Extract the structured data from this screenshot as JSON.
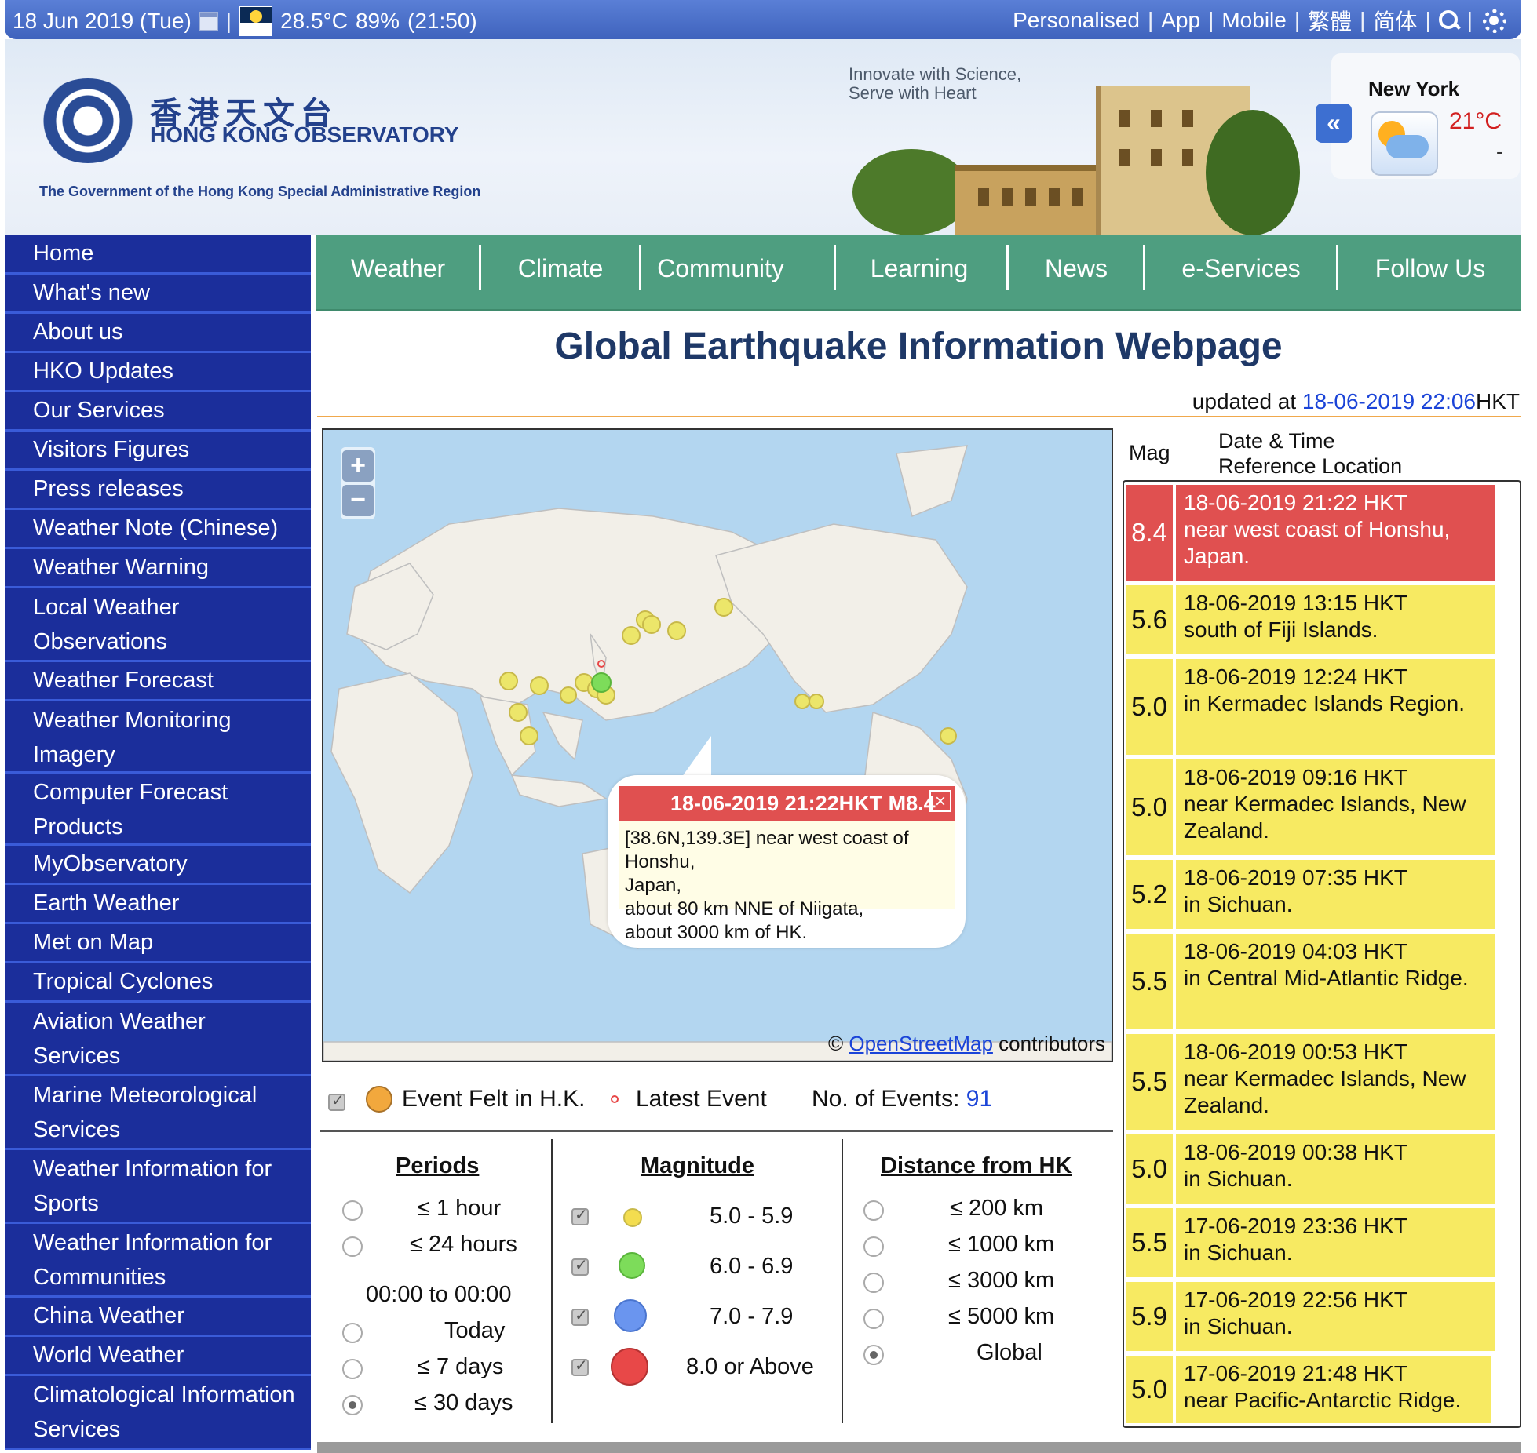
{
  "topbar": {
    "date": "18 Jun 2019 (Tue)",
    "temp": "28.5°C",
    "humidity": "89%",
    "time": "(21:50)",
    "links": [
      "Personalised",
      "App",
      "Mobile",
      "繁體",
      "简体"
    ]
  },
  "banner": {
    "logo_cn": "香港天文台",
    "logo_en": "HONG KONG OBSERVATORY",
    "gov": "The Government of the Hong Kong Special Administrative Region",
    "slogan": "Innovate with Science,\nServe with Heart",
    "city": "New York",
    "city_temp": "21°C",
    "city_dash": "-"
  },
  "sidebar": [
    "Home",
    "What's new",
    "About us",
    "HKO Updates",
    "Our Services",
    "Visitors Figures",
    "Press releases",
    "Weather Note (Chinese)",
    "Weather Warning",
    "Local Weather Observations",
    "Weather Forecast",
    "Weather Monitoring Imagery",
    "Computer Forecast Products",
    "MyObservatory",
    "Earth Weather",
    "Met on Map",
    "Tropical Cyclones",
    "Aviation Weather Services",
    "Marine Meteorological Services",
    "Weather Information for Sports",
    "Weather Information for Communities",
    "China Weather",
    "World Weather",
    "Climatological Information Services"
  ],
  "nav": [
    "Weather",
    "Climate",
    "Community",
    "Learning",
    "News",
    "e-Services",
    "Follow Us"
  ],
  "page": {
    "title": "Global Earthquake Information Webpage",
    "updated_label": "updated at ",
    "updated_ts": "18-06-2019 22:06",
    "updated_tz": "HKT"
  },
  "map": {
    "zoom_in": "+",
    "zoom_out": "−",
    "credit_prefix": "© ",
    "credit_link": "OpenStreetMap",
    "credit_suffix": " contributors",
    "popup_title": "18-06-2019 21:22HKT M8.4",
    "popup_lines": [
      "[38.6N,139.3E] near west coast of Honshu,",
      "Japan,",
      "about 80 km NNE of Niigata,",
      "about 3000 km of HK."
    ],
    "popup_close": "×"
  },
  "legend": {
    "felt": "Event Felt in H.K.",
    "latest": "Latest Event",
    "events_label": "No. of Events: ",
    "events_count": "91"
  },
  "filters": {
    "periods": {
      "title": "Periods",
      "options": [
        "≤  1 hour",
        "≤ 24 hours",
        "Today",
        "≤  7 days",
        "≤ 30 days"
      ],
      "range": "00:00 to 00:00",
      "selected": 4
    },
    "magnitude": {
      "title": "Magnitude",
      "options": [
        "5.0 - 5.9",
        "6.0 - 6.9",
        "7.0 - 7.9",
        "8.0 or Above"
      ],
      "colors": [
        "#f3dd4f",
        "#7ddc5a",
        "#6a95ef",
        "#e84848"
      ]
    },
    "distance": {
      "title": "Distance from HK",
      "options": [
        "≤  200 km",
        "≤  1000 km",
        "≤  3000 km",
        "≤  5000 km",
        "Global"
      ],
      "selected": 4
    }
  },
  "events": {
    "head_mag": "Mag",
    "head_dt": "Date & Time",
    "head_loc": "Reference Location",
    "rows": [
      {
        "mag": "8.4",
        "time": "18-06-2019 21:22 HKT",
        "loc": "near west coast of Honshu, Japan.",
        "level": "red"
      },
      {
        "mag": "5.6",
        "time": "18-06-2019 13:15 HKT",
        "loc": "south of Fiji Islands.",
        "level": "yel"
      },
      {
        "mag": "5.0",
        "time": "18-06-2019 12:24 HKT",
        "loc": "in Kermadec Islands Region.",
        "level": "yel"
      },
      {
        "mag": "5.0",
        "time": "18-06-2019 09:16 HKT",
        "loc": "near Kermadec Islands, New Zealand.",
        "level": "yel"
      },
      {
        "mag": "5.2",
        "time": "18-06-2019 07:35 HKT",
        "loc": "in Sichuan.",
        "level": "yel"
      },
      {
        "mag": "5.5",
        "time": "18-06-2019 04:03 HKT",
        "loc": "in Central Mid-Atlantic Ridge.",
        "level": "yel"
      },
      {
        "mag": "5.5",
        "time": "18-06-2019 00:53 HKT",
        "loc": "near Kermadec Islands, New Zealand.",
        "level": "yel"
      },
      {
        "mag": "5.0",
        "time": "18-06-2019 00:38 HKT",
        "loc": "in Sichuan.",
        "level": "yel"
      },
      {
        "mag": "5.5",
        "time": "17-06-2019 23:36 HKT",
        "loc": "in Sichuan.",
        "level": "yel"
      },
      {
        "mag": "5.9",
        "time": "17-06-2019 22:56 HKT",
        "loc": "in Sichuan.",
        "level": "yel"
      },
      {
        "mag": "5.0",
        "time": "17-06-2019 21:48 HKT",
        "loc": "near Pacific-Antarctic Ridge.",
        "level": "yel"
      }
    ]
  },
  "colors": {
    "sidebar_bg": "#1b2e9b",
    "nav_bg": "#4e9e80",
    "title": "#1e3867",
    "event_red": "#e05050",
    "event_yellow": "#f7ea62",
    "quake_dot": "#e8e05a"
  }
}
